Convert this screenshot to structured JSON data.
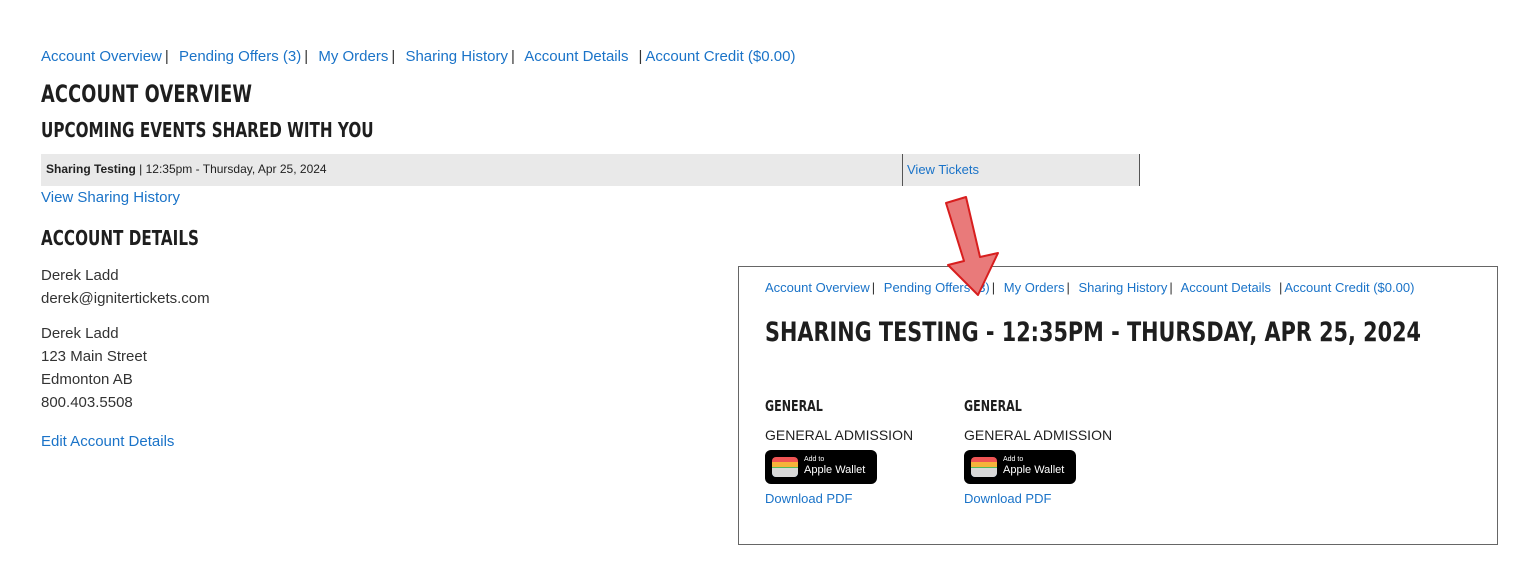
{
  "nav": {
    "items": [
      "Account Overview",
      "Pending Offers (3)",
      "My Orders",
      "Sharing History",
      "Account Details",
      "Account Credit ($0.00)"
    ]
  },
  "page_title": "ACCOUNT OVERVIEW",
  "upcoming": {
    "heading": "UPCOMING EVENTS SHARED WITH YOU",
    "event_name": "Sharing Testing",
    "event_datetime": "12:35pm - Thursday, Apr 25, 2024",
    "view_tickets": "View Tickets",
    "view_history": "View Sharing History"
  },
  "account_details": {
    "heading": "ACCOUNT DETAILS",
    "name": "Derek Ladd",
    "email": "derek@ignitertickets.com",
    "address_name": "Derek Ladd",
    "street": "123 Main Street",
    "city": "Edmonton AB",
    "phone": "800.403.5508",
    "edit_link": "Edit Account Details"
  },
  "panel": {
    "title": "SHARING TESTING - 12:35PM - THURSDAY, APR 25, 2024",
    "tickets": [
      {
        "class": "GENERAL",
        "name": "GENERAL ADMISSION",
        "wallet_small": "Add to",
        "wallet_big": "Apple Wallet",
        "pdf": "Download PDF"
      },
      {
        "class": "GENERAL",
        "name": "GENERAL ADMISSION",
        "wallet_small": "Add to",
        "wallet_big": "Apple Wallet",
        "pdf": "Download PDF"
      }
    ]
  },
  "colors": {
    "link": "#1a73c8",
    "row_bg": "#e9e9e9",
    "arrow_fill": "#e97a7a",
    "arrow_stroke": "#d81e1e"
  }
}
